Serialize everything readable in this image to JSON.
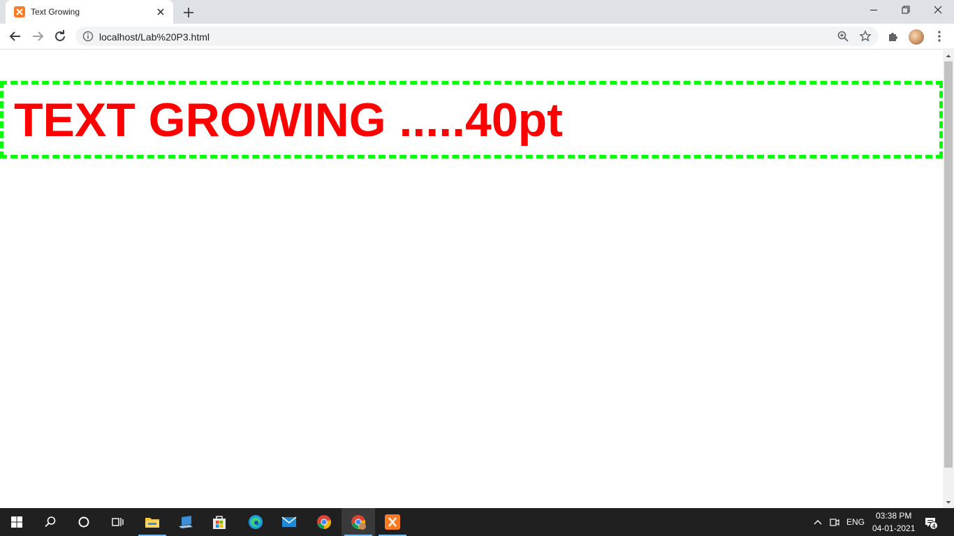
{
  "browser": {
    "tab_title": "Text Growing",
    "url": "localhost/Lab%20P3.html"
  },
  "page": {
    "heading": "TEXT GROWING .....40pt",
    "text_color": "#ff0000",
    "border_color": "#00ff00"
  },
  "taskbar": {
    "apps": [
      "start",
      "search",
      "cortana",
      "task-view",
      "file-explorer",
      "laptop",
      "store",
      "edge",
      "mail",
      "chrome",
      "chrome-profile",
      "xampp"
    ],
    "language": "ENG",
    "time": "03:38 PM",
    "date": "04-01-2021",
    "notification_count": "4"
  }
}
